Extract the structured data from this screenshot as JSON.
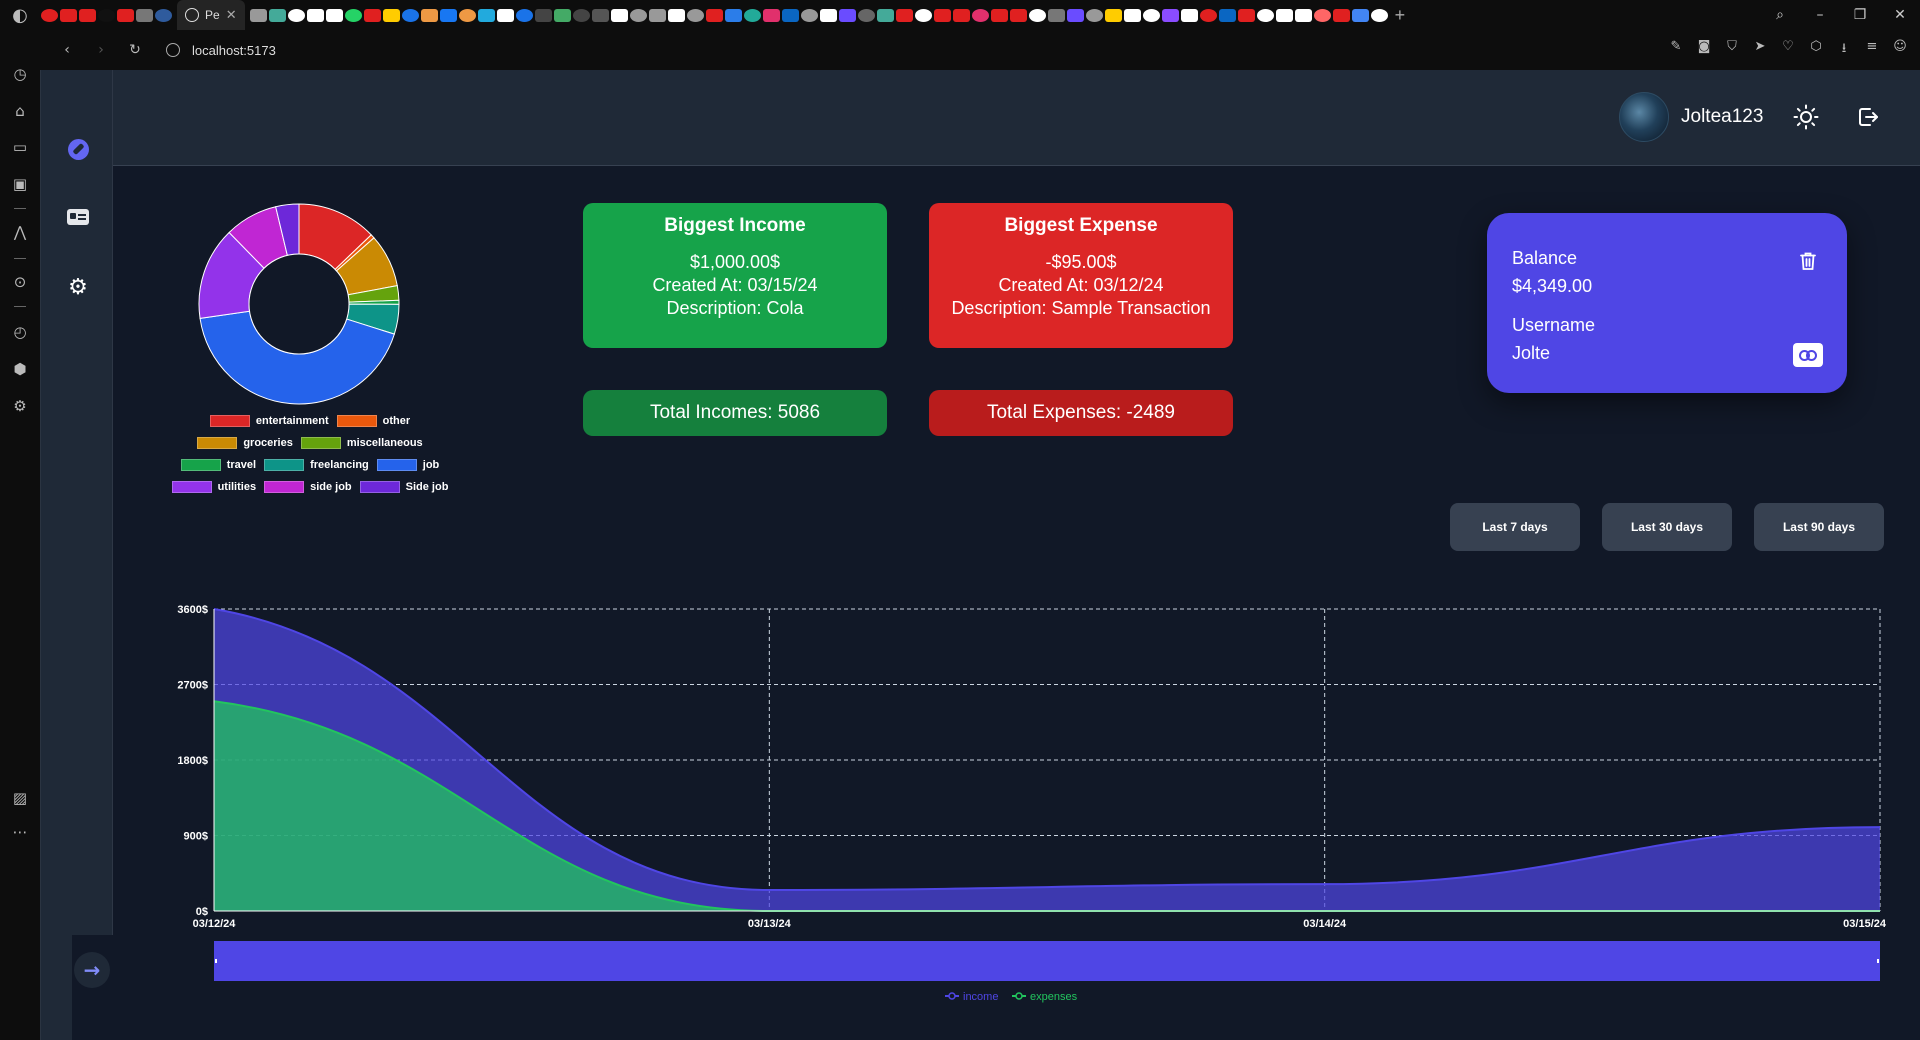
{
  "browser": {
    "active_tab_title": "Pe",
    "url": "localhost:5173",
    "tab_favicon_colors": [
      "#e02020",
      "#e02020",
      "#e02020",
      "#111",
      "#e02020",
      "#777",
      "#2f5b9d",
      "#999",
      "#4a9",
      "#fff",
      "#fff",
      "#fff",
      "#25d366",
      "#e02020",
      "#ffcc00",
      "#1a73e8",
      "#e94",
      "#1877f2",
      "#e94",
      "#2ad",
      "#fff",
      "#1a73e8",
      "#444",
      "#4a6",
      "#444",
      "#555",
      "#fff",
      "#999",
      "#999",
      "#fff",
      "#999",
      "#e02020",
      "#2b7de9",
      "#2a9",
      "#e1306c",
      "#0a66c2",
      "#999",
      "#fff",
      "#6a4cff",
      "#666",
      "#4a9",
      "#e02020",
      "#fff",
      "#e02020",
      "#e02020",
      "#e1306c",
      "#e02020",
      "#e02020",
      "#fff",
      "#777",
      "#6a4cff",
      "#999",
      "#fc0",
      "#fff",
      "#fff",
      "#8a4cff",
      "#fff",
      "#e02020",
      "#0a66c2",
      "#e02020",
      "#fff",
      "#fff",
      "#fff",
      "#f66",
      "#e02020",
      "#4285f4",
      "#fff"
    ]
  },
  "sidebar": {
    "items": [
      {
        "name": "explore",
        "icon": "compass-icon",
        "active": true
      },
      {
        "name": "cards",
        "icon": "id-card-icon",
        "active": false
      },
      {
        "name": "settings",
        "icon": "gear-icon",
        "active": false
      }
    ],
    "expand_icon": "→"
  },
  "header": {
    "username": "Joltea123",
    "theme_icon": "sun-icon",
    "logout_icon": "logout-icon"
  },
  "cards": {
    "biggest_income": {
      "title": "Biggest Income",
      "amount": "$1,000.00$",
      "created": "Created At: 03/15/24",
      "description": "Description: Cola"
    },
    "biggest_expense": {
      "title": "Biggest Expense",
      "amount": "-$95.00$",
      "created": "Created At: 03/12/24",
      "description": "Description: Sample Transaction"
    },
    "total_incomes": "Total Incomes: 5086",
    "total_expenses": "Total Expenses: -2489"
  },
  "balance_card": {
    "balance_label": "Balance",
    "balance_value": "$4,349.00",
    "username_label": "Username",
    "username_value": "Jolte"
  },
  "range_buttons": [
    "Last 7 days",
    "Last 30 days",
    "Last 90 days"
  ],
  "colors": {
    "income": "#4f46e5",
    "expenses": "#22c55e",
    "income_card": "#16a34a",
    "expense_card": "#dc2626",
    "accent": "#6366f1"
  },
  "chart_data": [
    {
      "type": "pie",
      "title": "",
      "categories": [
        "entertainment",
        "other",
        "groceries",
        "miscellaneous",
        "travel",
        "freelancing",
        "job",
        "utilities",
        "side job",
        "Side job"
      ],
      "values": [
        12,
        0.6,
        8,
        2.2,
        0.6,
        4.5,
        40,
        14,
        8,
        3.5
      ],
      "colors": [
        "#dc2626",
        "#ea580c",
        "#ca8a04",
        "#65a30d",
        "#16a34a",
        "#0d9488",
        "#2563eb",
        "#9333ea",
        "#c026d3",
        "#6d28d9"
      ],
      "legend_position": "bottom"
    },
    {
      "type": "area",
      "title": "",
      "x": [
        "03/12/24",
        "03/13/24",
        "03/14/24",
        "03/15/24"
      ],
      "series": [
        {
          "name": "income",
          "values": [
            3600,
            250,
            320,
            1000
          ],
          "color": "#4f46e5"
        },
        {
          "name": "expenses",
          "values": [
            2500,
            0,
            0,
            0
          ],
          "color": "#22c55e"
        }
      ],
      "yticks": [
        "0$",
        "900$",
        "1800$",
        "2700$",
        "3600$"
      ],
      "ylim": [
        0,
        3600
      ],
      "grid": true,
      "legend_position": "bottom"
    }
  ]
}
